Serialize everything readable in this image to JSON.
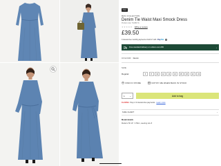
{
  "product": {
    "badge": "New",
    "brand": "M&S COLLECTION",
    "title": "Denim Tie Waist Maxi Smock Dress",
    "code": "Product code: T424817G",
    "stars": 5,
    "write_review": "Write a review",
    "price": "£39.50",
    "paypal_text": "3 interest-free monthly payments of £13.17 with",
    "paypal_brand_a": "Pay",
    "paypal_brand_b": "Pal",
    "info_glyph": "i"
  },
  "delivery": {
    "text": "Free standard delivery on orders over £50",
    "icon": "truck-icon",
    "chevron": "›",
    "bg": "#1d4a36"
  },
  "colour": {
    "label": "COLOUR:",
    "value": "Denim"
  },
  "size": {
    "label": "SIZE",
    "fit": "Regular",
    "options": [
      "6",
      "8",
      "10",
      "12",
      "14",
      "16",
      "18",
      "20",
      "22",
      "24"
    ]
  },
  "links": {
    "find_in_store": "FIND IN STORE",
    "notify": "NOTIFY ME WHEN BACK IN STOCK"
  },
  "buy": {
    "quantity": "1",
    "quantity_caret": "⌄",
    "add_to_bag": "Add to bag",
    "button_color": "#dbe57a"
  },
  "promo": {
    "logo": "KLARNA",
    "text": "Pay in 3 interest-free payments",
    "link": "Learn more"
  },
  "accordion": {
    "size_chart": "SIZE CHART",
    "chevron": "⌄"
  },
  "model": {
    "heading": "Model details",
    "text": "Model is 5ft 10\" / 178cm, wearing size 8"
  }
}
